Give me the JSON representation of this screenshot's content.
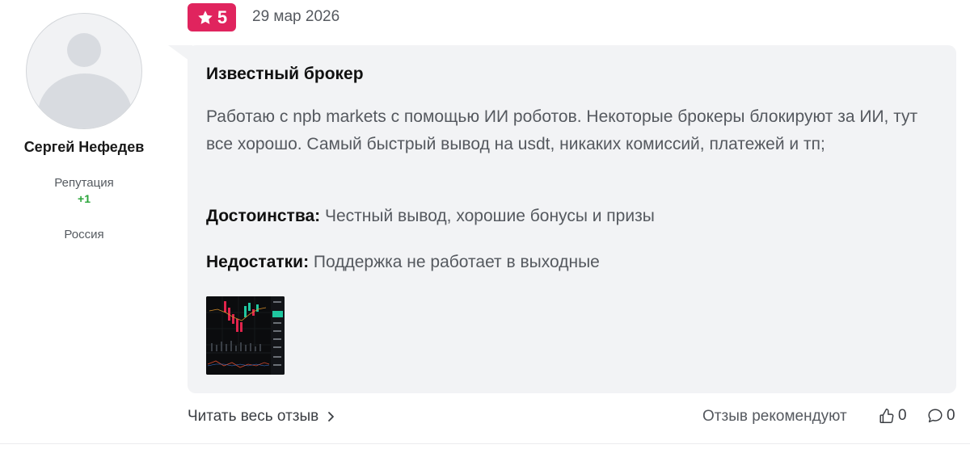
{
  "author": {
    "name": "Сергей Нефедев",
    "reputation_label": "Репутация",
    "reputation_value": "+1",
    "country": "Россия"
  },
  "review": {
    "rating": "5",
    "date": "29 мар 2026",
    "title": "Известный брокер",
    "text": "Работаю с npb markets с помощью ИИ роботов. Некоторые брокеры блокируют за ИИ, тут все хорошо. Самый быстрый вывод на usdt, никаких комиссий, платежей и тп;",
    "pros_label": "Достоинства:",
    "pros_text": " Честный вывод, хорошие бонусы и призы",
    "cons_label": "Недостатки:",
    "cons_text": " Поддержка не работает в выходные"
  },
  "footer": {
    "read_more": "Читать весь отзыв",
    "recommend_label": "Отзыв рекомендуют",
    "likes_count": "0",
    "comments_count": "0"
  },
  "colors": {
    "badge": "#e0245e",
    "bubble": "#f2f3f5",
    "reputation_positive": "#2aa53a"
  },
  "icons": {
    "badge": "star-icon",
    "read_more": "chevron-right-icon",
    "likes": "thumbs-up-icon",
    "comments": "comment-icon"
  }
}
